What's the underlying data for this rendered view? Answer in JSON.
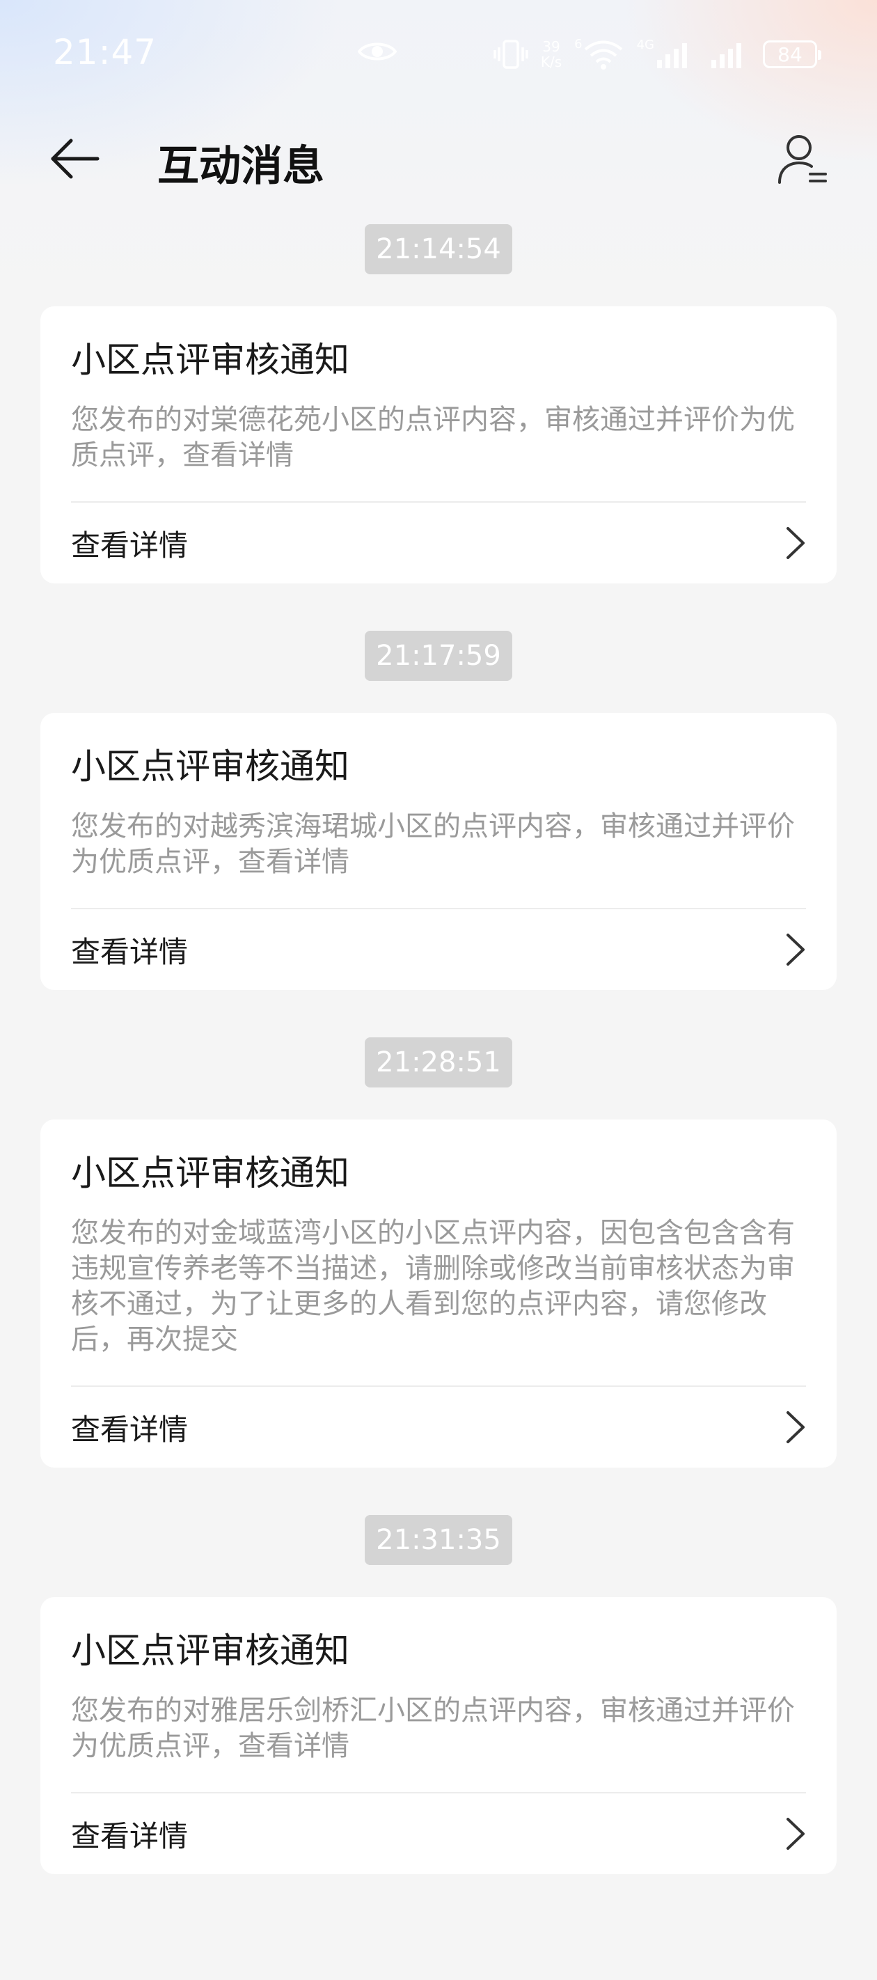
{
  "status_bar": {
    "time": "21:47",
    "net_speed_value": "39",
    "net_speed_unit": "K/s",
    "wifi_label": "6",
    "network_type": "4G",
    "battery": "84"
  },
  "header": {
    "title": "互动消息"
  },
  "messages": [
    {
      "time": "21:14:54",
      "title": "小区点评审核通知",
      "body": "您发布的对棠德花苑小区的点评内容，审核通过并评价为优质点评，查看详情",
      "action_label": "查看详情"
    },
    {
      "time": "21:17:59",
      "title": "小区点评审核通知",
      "body": "您发布的对越秀滨海珺城小区的点评内容，审核通过并评价为优质点评，查看详情",
      "action_label": "查看详情"
    },
    {
      "time": "21:28:51",
      "title": "小区点评审核通知",
      "body": "您发布的对金域蓝湾小区的小区点评内容，因包含包含含有违规宣传养老等不当描述，请删除或修改当前审核状态为审核不通过，为了让更多的人看到您的点评内容，请您修改后，再次提交",
      "action_label": "查看详情"
    },
    {
      "time": "21:31:35",
      "title": "小区点评审核通知",
      "body": "您发布的对雅居乐剑桥汇小区的点评内容，审核通过并评价为优质点评，查看详情",
      "action_label": "查看详情"
    }
  ]
}
